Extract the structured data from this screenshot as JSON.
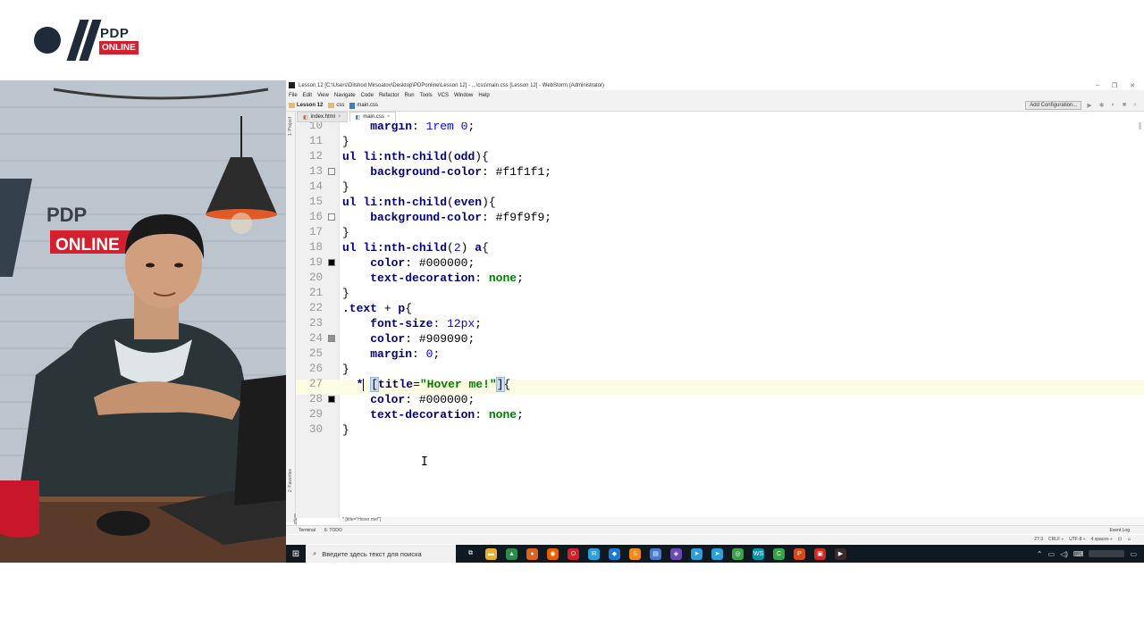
{
  "logo": {
    "brand": "PDP",
    "sub": "ONLINE"
  },
  "ide": {
    "window_title": "Lesson 12 [C:\\Users\\Dilshod Mirsoatov\\Desktop\\PDPonline\\Lesson 12] - ...\\css\\main.css [Lesson 12] - WebStorm (Administrator)",
    "window_buttons": [
      "–",
      "❐",
      "✕"
    ],
    "menu": [
      "File",
      "Edit",
      "View",
      "Navigate",
      "Code",
      "Refactor",
      "Run",
      "Tools",
      "VCS",
      "Window",
      "Help"
    ],
    "breadcrumbs": [
      "Lesson 12",
      "css",
      "main.css"
    ],
    "add_configuration": "Add Configuration...",
    "tabs": [
      {
        "label": "index.html",
        "active": false
      },
      {
        "label": "main.css",
        "active": true
      }
    ],
    "left_tools": [
      "1: Project",
      "2: Favorites",
      "Z: Structure"
    ],
    "code": [
      {
        "n": "10",
        "segs": [
          [
            "p",
            "    "
          ],
          [
            "prop",
            "margin"
          ],
          [
            "v",
            ": "
          ],
          [
            "num",
            "1rem"
          ],
          [
            "v",
            " "
          ],
          [
            "num",
            "0"
          ],
          [
            "v",
            ";"
          ]
        ]
      },
      {
        "n": "11",
        "segs": [
          [
            "v",
            "}"
          ]
        ]
      },
      {
        "n": "12",
        "segs": [
          [
            "sel",
            "ul li:nth-child"
          ],
          [
            "v",
            "("
          ],
          [
            "sel",
            "odd"
          ],
          [
            "v",
            "){"
          ]
        ]
      },
      {
        "n": "13",
        "segs": [
          [
            "p",
            "    "
          ],
          [
            "prop",
            "background-color"
          ],
          [
            "v",
            ": #f1f1f1;"
          ]
        ],
        "swatch": "#f1f1f1"
      },
      {
        "n": "14",
        "segs": [
          [
            "v",
            "}"
          ]
        ]
      },
      {
        "n": "15",
        "segs": [
          [
            "sel",
            "ul li:nth-child"
          ],
          [
            "v",
            "("
          ],
          [
            "sel",
            "even"
          ],
          [
            "v",
            "){"
          ]
        ]
      },
      {
        "n": "16",
        "segs": [
          [
            "p",
            "    "
          ],
          [
            "prop",
            "background-color"
          ],
          [
            "v",
            ": #f9f9f9;"
          ]
        ],
        "swatch": "#f9f9f9"
      },
      {
        "n": "17",
        "segs": [
          [
            "v",
            "}"
          ]
        ]
      },
      {
        "n": "18",
        "segs": [
          [
            "sel",
            "ul li:nth-child"
          ],
          [
            "v",
            "("
          ],
          [
            "num",
            "2"
          ],
          [
            "v",
            ") "
          ],
          [
            "sel",
            "a"
          ],
          [
            "v",
            "{"
          ]
        ]
      },
      {
        "n": "19",
        "segs": [
          [
            "p",
            "    "
          ],
          [
            "prop",
            "color"
          ],
          [
            "v",
            ": #000000;"
          ]
        ],
        "swatch": "#000000"
      },
      {
        "n": "20",
        "segs": [
          [
            "p",
            "    "
          ],
          [
            "prop",
            "text-decoration"
          ],
          [
            "v",
            ": "
          ],
          [
            "kw",
            "none"
          ],
          [
            "v",
            ";"
          ]
        ]
      },
      {
        "n": "21",
        "segs": [
          [
            "v",
            "}"
          ]
        ]
      },
      {
        "n": "22",
        "segs": [
          [
            "sel",
            ".text"
          ],
          [
            "v",
            " + "
          ],
          [
            "sel",
            "p"
          ],
          [
            "v",
            "{"
          ]
        ]
      },
      {
        "n": "23",
        "segs": [
          [
            "p",
            "    "
          ],
          [
            "prop",
            "font-size"
          ],
          [
            "v",
            ": "
          ],
          [
            "num",
            "12px"
          ],
          [
            "v",
            ";"
          ]
        ]
      },
      {
        "n": "24",
        "segs": [
          [
            "p",
            "    "
          ],
          [
            "prop",
            "color"
          ],
          [
            "v",
            ": #909090;"
          ]
        ],
        "swatch": "#909090"
      },
      {
        "n": "25",
        "segs": [
          [
            "p",
            "    "
          ],
          [
            "prop",
            "margin"
          ],
          [
            "v",
            ": "
          ],
          [
            "num",
            "0"
          ],
          [
            "v",
            ";"
          ]
        ]
      },
      {
        "n": "26",
        "segs": [
          [
            "v",
            "}"
          ]
        ]
      },
      {
        "n": "27",
        "segs": [
          [
            "p",
            "  "
          ],
          [
            "sel",
            "*"
          ],
          [
            "caret",
            ""
          ],
          [
            "p",
            " "
          ],
          [
            "bl",
            "["
          ],
          [
            "attr",
            "title"
          ],
          [
            "v",
            "="
          ],
          [
            "str",
            "\"Hover me!\""
          ],
          [
            "bl",
            "]"
          ],
          [
            "v",
            "{"
          ]
        ]
      },
      {
        "n": "28",
        "segs": [
          [
            "p",
            "    "
          ],
          [
            "prop",
            "color"
          ],
          [
            "v",
            ": #000000;"
          ]
        ],
        "swatch": "#000000"
      },
      {
        "n": "29",
        "segs": [
          [
            "p",
            "    "
          ],
          [
            "prop",
            "text-decoration"
          ],
          [
            "v",
            ": "
          ],
          [
            "kw",
            "none"
          ],
          [
            "v",
            ";"
          ]
        ]
      },
      {
        "n": "30",
        "segs": [
          [
            "v",
            "}"
          ]
        ]
      }
    ],
    "editor_breadcrumb": "* [title=\"Hover me!\"]",
    "bottom_tools": [
      "Terminal",
      "6: TODO"
    ],
    "event_log": "Event Log",
    "status": [
      "27:3",
      "CRLF ÷",
      "UTF-8 ÷",
      "4 spaces ÷"
    ]
  },
  "taskbar": {
    "search_placeholder": "Введите здесь текст для поиска",
    "apps": [
      {
        "name": "task-view",
        "color": "#101820",
        "glyph": "⧉"
      },
      {
        "name": "file-explorer",
        "color": "#e8b030",
        "glyph": "▬"
      },
      {
        "name": "app-green",
        "color": "#2d8a4a",
        "glyph": "▲"
      },
      {
        "name": "app-orange",
        "color": "#e06020",
        "glyph": "●"
      },
      {
        "name": "firefox",
        "color": "#e66000",
        "glyph": "◉"
      },
      {
        "name": "opera",
        "color": "#d0202a",
        "glyph": "O"
      },
      {
        "name": "messenger",
        "color": "#2a9fd8",
        "glyph": "✉"
      },
      {
        "name": "vscode",
        "color": "#1e7ad0",
        "glyph": "◆"
      },
      {
        "name": "sublime",
        "color": "#f08a1c",
        "glyph": "S"
      },
      {
        "name": "save-app",
        "color": "#4a7ad0",
        "glyph": "▤"
      },
      {
        "name": "app-purple",
        "color": "#6a4ab0",
        "glyph": "◈"
      },
      {
        "name": "telegram",
        "color": "#2a9fd8",
        "glyph": "➤"
      },
      {
        "name": "telegram-2",
        "color": "#2a9fd8",
        "glyph": "➤"
      },
      {
        "name": "chrome",
        "color": "#3aa04a",
        "glyph": "◎"
      },
      {
        "name": "webstorm",
        "color": "#0d8fa8",
        "glyph": "WS"
      },
      {
        "name": "camtasia",
        "color": "#3aa04a",
        "glyph": "C"
      },
      {
        "name": "powerpoint",
        "color": "#d04a20",
        "glyph": "P"
      },
      {
        "name": "app-red",
        "color": "#d02a20",
        "glyph": "▣"
      },
      {
        "name": "media",
        "color": "#3a2a2a",
        "glyph": "▶"
      }
    ],
    "tray": [
      "⌃",
      "▭",
      "◁)",
      "⌨"
    ]
  }
}
